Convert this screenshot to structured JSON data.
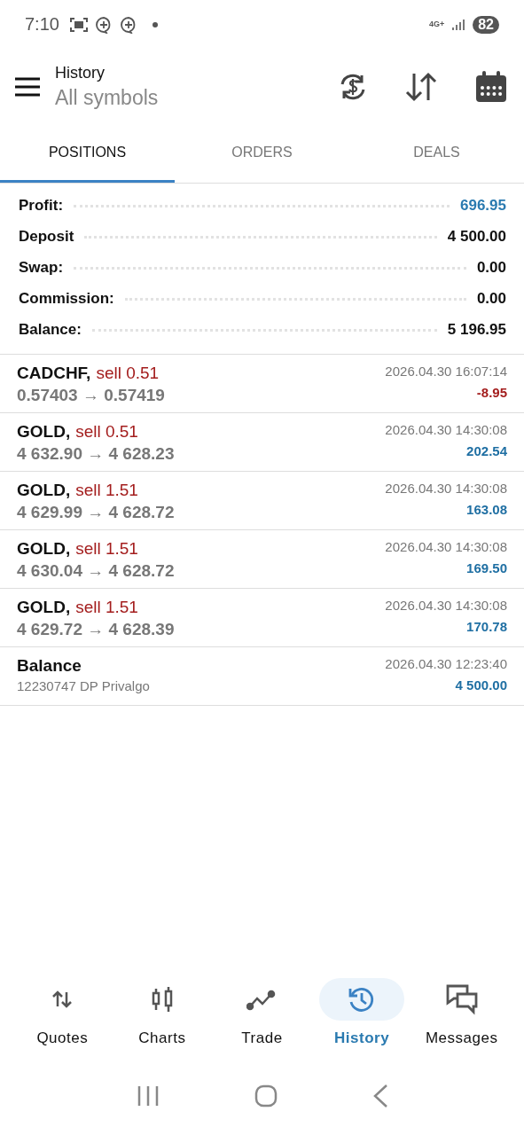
{
  "status_bar": {
    "time": "7:10",
    "network": "4G+",
    "battery": "82"
  },
  "header": {
    "title": "History",
    "subtitle": "All symbols"
  },
  "tabs": [
    {
      "label": "POSITIONS",
      "selected": true
    },
    {
      "label": "ORDERS",
      "selected": false
    },
    {
      "label": "DEALS",
      "selected": false
    }
  ],
  "summary": [
    {
      "label": "Profit:",
      "value": "696.95",
      "highlight": true
    },
    {
      "label": "Deposit",
      "value": "4 500.00",
      "highlight": false
    },
    {
      "label": "Swap:",
      "value": "0.00",
      "highlight": false
    },
    {
      "label": "Commission:",
      "value": "0.00",
      "highlight": false
    },
    {
      "label": "Balance:",
      "value": "5 196.95",
      "highlight": false
    }
  ],
  "deals": [
    {
      "kind": "trade",
      "symbol": "CADCHF,",
      "action": "sell 0.51",
      "detail": "0.57403 → 0.57419",
      "time": "2026.04.30 16:07:14",
      "amount": "-8.95",
      "loss": true
    },
    {
      "kind": "trade",
      "symbol": "GOLD,",
      "action": "sell 0.51",
      "detail": "4 632.90 → 4 628.23",
      "time": "2026.04.30 14:30:08",
      "amount": "202.54",
      "loss": false
    },
    {
      "kind": "trade",
      "symbol": "GOLD,",
      "action": "sell 1.51",
      "detail": "4 629.99 → 4 628.72",
      "time": "2026.04.30 14:30:08",
      "amount": "163.08",
      "loss": false
    },
    {
      "kind": "trade",
      "symbol": "GOLD,",
      "action": "sell 1.51",
      "detail": "4 630.04 → 4 628.72",
      "time": "2026.04.30 14:30:08",
      "amount": "169.50",
      "loss": false
    },
    {
      "kind": "trade",
      "symbol": "GOLD,",
      "action": "sell 1.51",
      "detail": "4 629.72 → 4 628.39",
      "time": "2026.04.30 14:30:08",
      "amount": "170.78",
      "loss": false
    },
    {
      "kind": "balance",
      "symbol": "Balance",
      "detail": "12230747 DP Privalgo",
      "time": "2026.04.30 12:23:40",
      "amount": "4 500.00",
      "loss": false
    }
  ],
  "bottom_nav": [
    {
      "label": "Quotes",
      "selected": false
    },
    {
      "label": "Charts",
      "selected": false
    },
    {
      "label": "Trade",
      "selected": false
    },
    {
      "label": "History",
      "selected": true
    },
    {
      "label": "Messages",
      "selected": false
    }
  ]
}
